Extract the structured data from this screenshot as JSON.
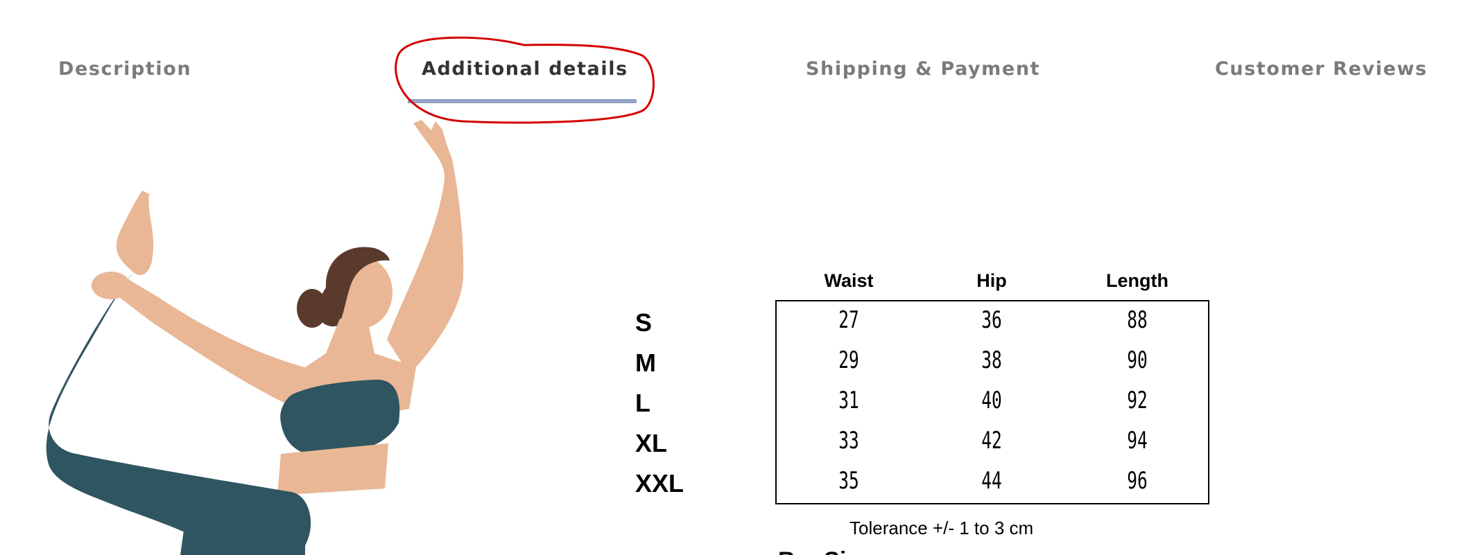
{
  "tabs": [
    {
      "label": "Description",
      "active": false
    },
    {
      "label": "Additional details",
      "active": true
    },
    {
      "label": "Shipping & Payment",
      "active": false
    },
    {
      "label": "Customer Reviews",
      "active": false
    }
  ],
  "colors": {
    "active_underline": "#93a3c7",
    "annotation": "#d40000",
    "inactive_tab_text": "#7b7b7b",
    "active_tab_text": "#333333",
    "garment": "#2f5560",
    "skin": "#e9b796"
  },
  "size_chart": {
    "headers": [
      "Waist",
      "Hip",
      "Length"
    ],
    "rows": [
      {
        "size": "S",
        "waist": "27",
        "hip": "36",
        "length": "88"
      },
      {
        "size": "M",
        "waist": "29",
        "hip": "38",
        "length": "90"
      },
      {
        "size": "L",
        "waist": "31",
        "hip": "40",
        "length": "92"
      },
      {
        "size": "XL",
        "waist": "33",
        "hip": "42",
        "length": "94"
      },
      {
        "size": "XXL",
        "waist": "35",
        "hip": "44",
        "length": "96"
      }
    ],
    "tolerance": "Tolerance +/- 1 to 3 cm",
    "cut_off_text": "Bra  Size"
  }
}
